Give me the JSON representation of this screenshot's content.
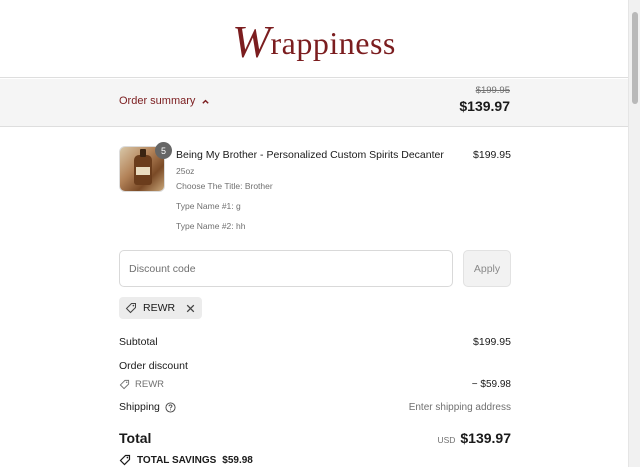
{
  "brand": {
    "logo_first": "W",
    "logo_rest": "rappiness",
    "color": "#7b1d1f"
  },
  "summary": {
    "toggle_label": "Order summary",
    "compare_price": "$199.95",
    "total": "$139.97"
  },
  "line_item": {
    "quantity": "5",
    "title": "Being My Brother - Personalized Custom Spirits Decanter",
    "size": "25oz",
    "option_title": "Choose The Title: Brother",
    "option_name1": "Type Name #1: g",
    "option_name2": "Type Name #2: hh",
    "price": "$199.95"
  },
  "discount": {
    "placeholder": "Discount code",
    "apply_label": "Apply",
    "applied_code": "REWR"
  },
  "totals": {
    "subtotal_label": "Subtotal",
    "subtotal_value": "$199.95",
    "order_discount_label": "Order discount",
    "discount_code": "REWR",
    "discount_value": "− $59.98",
    "shipping_label": "Shipping",
    "shipping_value": "Enter shipping address",
    "total_label": "Total",
    "currency": "USD",
    "total_value": "$139.97",
    "savings_label": "TOTAL SAVINGS",
    "savings_value": "$59.98"
  },
  "icons": {
    "chevron": "chevron-up-icon",
    "tag": "tag-icon",
    "close": "close-icon",
    "help": "question-circle-icon"
  }
}
